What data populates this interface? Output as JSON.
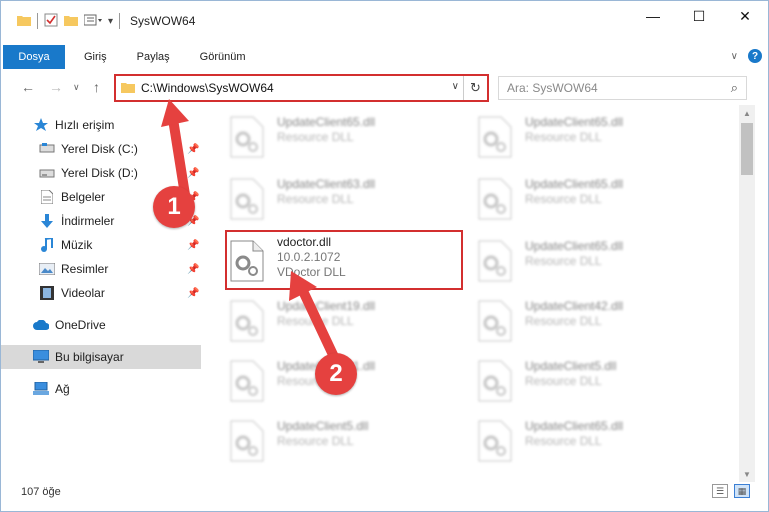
{
  "window": {
    "title": "SysWOW64"
  },
  "ribbon": {
    "tabs": [
      "Dosya",
      "Giriş",
      "Paylaş",
      "Görünüm"
    ],
    "active_index": 0
  },
  "address": {
    "path": "C:\\Windows\\SysWOW64"
  },
  "search": {
    "placeholder": "Ara: SysWOW64"
  },
  "sidebar": {
    "quick_access": "Hızlı erişim",
    "items": [
      {
        "label": "Yerel Disk (C:)",
        "icon": "drive-icon",
        "pinned": true
      },
      {
        "label": "Yerel Disk (D:)",
        "icon": "drive-icon",
        "pinned": true
      },
      {
        "label": "Belgeler",
        "icon": "documents-icon",
        "pinned": true
      },
      {
        "label": "İndirmeler",
        "icon": "downloads-icon",
        "pinned": true
      },
      {
        "label": "Müzik",
        "icon": "music-icon",
        "pinned": true
      },
      {
        "label": "Resimler",
        "icon": "pictures-icon",
        "pinned": true
      },
      {
        "label": "Videolar",
        "icon": "videos-icon",
        "pinned": true
      }
    ],
    "onedrive": "OneDrive",
    "this_pc": "Bu bilgisayar",
    "network": "Ağ"
  },
  "files": [
    {
      "name": "UpdateClient65.dll",
      "desc": "Resource DLL"
    },
    {
      "name": "UpdateClient65.dll",
      "desc": "Resource DLL"
    },
    {
      "name": "UpdateClient63.dll",
      "desc": "Resource DLL"
    },
    {
      "name": "UpdateClient65.dll",
      "desc": "Resource DLL"
    },
    {
      "name": "vdoctor.dll",
      "version": "10.0.2.1072",
      "desc": "VDoctor DLL"
    },
    {
      "name": "UpdateClient65.dll",
      "desc": "Resource DLL"
    },
    {
      "name": "UpdateClient19.dll",
      "desc": "Resource DLL"
    },
    {
      "name": "UpdateClient42.dll",
      "desc": "Resource DLL"
    },
    {
      "name": "UpdateClient71.dll",
      "desc": "Resource DLL"
    },
    {
      "name": "UpdateClient5.dll",
      "desc": "Resource DLL"
    },
    {
      "name": "UpdateClient5.dll",
      "desc": "Resource DLL"
    },
    {
      "name": "UpdateClient65.dll",
      "desc": "Resource DLL"
    }
  ],
  "callouts": {
    "step1": "1",
    "step2": "2"
  },
  "status": {
    "count": "107 öğe"
  },
  "colors": {
    "accent": "#1979ca",
    "highlight": "#d32f2f",
    "callout": "#e5413f"
  }
}
